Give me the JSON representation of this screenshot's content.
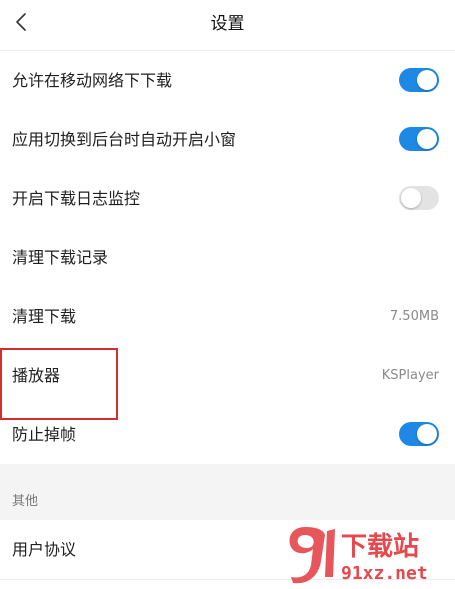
{
  "header": {
    "title": "设置"
  },
  "rows": [
    {
      "label": "允许在移动网络下下载",
      "toggle": "on"
    },
    {
      "label": "应用切换到后台时自动开启小窗",
      "toggle": "on"
    },
    {
      "label": "开启下载日志监控",
      "toggle": "off"
    },
    {
      "label": "清理下载记录"
    },
    {
      "label": "清理下载",
      "value": "7.50MB"
    },
    {
      "label": "播放器",
      "value": "KSPlayer"
    },
    {
      "label": "防止掉帧",
      "toggle": "on"
    }
  ],
  "section": {
    "title": "其他"
  },
  "other_rows": [
    {
      "label": "用户协议"
    }
  ],
  "watermark": {
    "brand": "下载站",
    "domain": "91xz.net"
  },
  "colors": {
    "accent": "#1e88e5",
    "highlight": "#d32f2f",
    "watermark": "#e5484d"
  }
}
